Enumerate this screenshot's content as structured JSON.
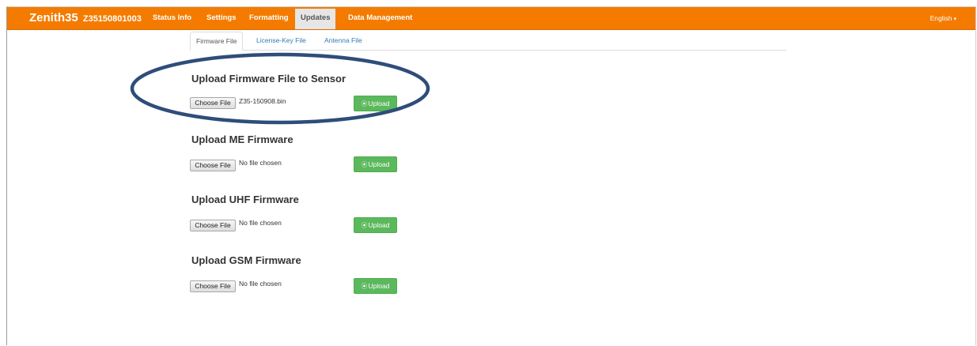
{
  "brand": {
    "name": "Zenith35",
    "serial": "Z35150801003"
  },
  "nav": [
    {
      "label": "Status Info"
    },
    {
      "label": "Settings"
    },
    {
      "label": "Formatting"
    },
    {
      "label": "Updates"
    },
    {
      "label": "Data Management"
    }
  ],
  "language": {
    "label": "English"
  },
  "tabs": [
    {
      "label": "Firmware File"
    },
    {
      "label": "License-Key File"
    },
    {
      "label": "Antenna File"
    }
  ],
  "sections": [
    {
      "title": "Upload Firmware File to Sensor",
      "choose_label": "Choose File",
      "file_name": "Z35-150908.bin",
      "upload_label": "Upload"
    },
    {
      "title": "Upload ME Firmware",
      "choose_label": "Choose File",
      "file_name": "No file chosen",
      "upload_label": "Upload"
    },
    {
      "title": "Upload UHF Firmware",
      "choose_label": "Choose File",
      "file_name": "No file chosen",
      "upload_label": "Upload"
    },
    {
      "title": "Upload GSM Firmware",
      "choose_label": "Choose File",
      "file_name": "No file chosen",
      "upload_label": "Upload"
    }
  ],
  "colors": {
    "navbar": "#f47b00",
    "upload_button": "#5cb85c",
    "link": "#337ab7",
    "callout_ring": "#2e4d7a"
  },
  "active_nav": "Updates",
  "active_tab": "Firmware File"
}
